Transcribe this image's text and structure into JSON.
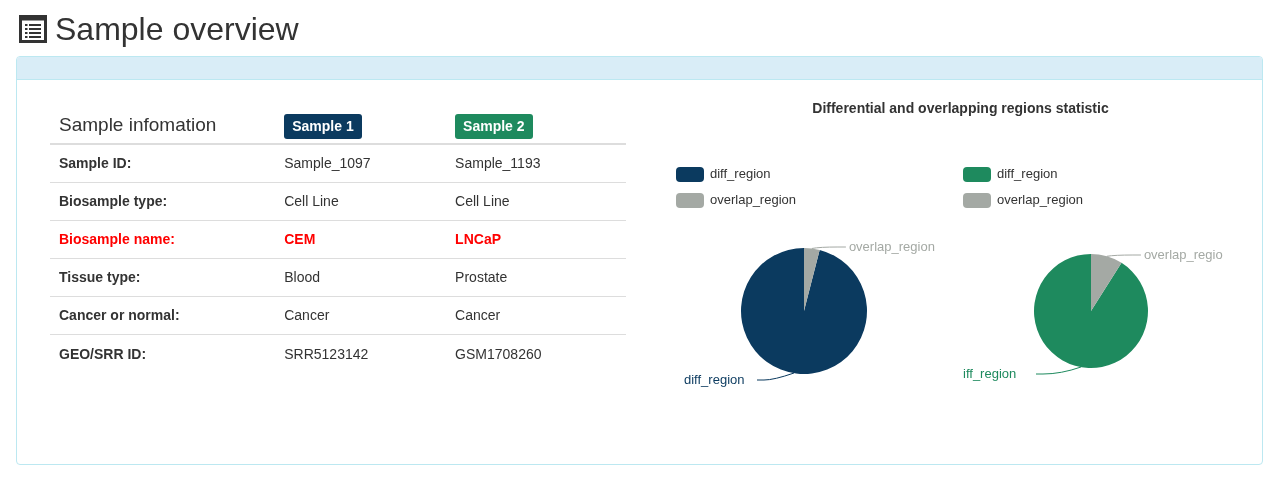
{
  "page_title": "Sample overview",
  "table": {
    "heading": "Sample infomation",
    "samples": [
      {
        "label": "Sample 1",
        "color": "#0b3a5f"
      },
      {
        "label": "Sample 2",
        "color": "#1e8a5e"
      }
    ],
    "rows": [
      {
        "label": "Sample ID:",
        "values": [
          "Sample_1097",
          "Sample_1193"
        ],
        "highlighted": false
      },
      {
        "label": "Biosample type:",
        "values": [
          "Cell Line",
          "Cell Line"
        ],
        "highlighted": false
      },
      {
        "label": "Biosample name:",
        "values": [
          "CEM",
          "LNCaP"
        ],
        "highlighted": true
      },
      {
        "label": "Tissue type:",
        "values": [
          "Blood",
          "Prostate"
        ],
        "highlighted": false
      },
      {
        "label": "Cancer or normal:",
        "values": [
          "Cancer",
          "Cancer"
        ],
        "highlighted": false
      },
      {
        "label": "GEO/SRR ID:",
        "values": [
          "SRR5123142",
          "GSM1708260"
        ],
        "highlighted": false
      }
    ]
  },
  "charts_title": "Differential and overlapping regions statistic",
  "charts": [
    {
      "legend": [
        {
          "label": "diff_region",
          "color": "#0b3a5f"
        },
        {
          "label": "overlap_region",
          "color": "#a4a9a4"
        }
      ],
      "slice_labels": [
        "diff_region",
        "overlap_region"
      ]
    },
    {
      "legend": [
        {
          "label": "diff_region",
          "color": "#1e8a5e"
        },
        {
          "label": "overlap_region",
          "color": "#a4a9a4"
        }
      ],
      "slice_labels": [
        "iff_region",
        "overlap_regio"
      ]
    }
  ]
}
